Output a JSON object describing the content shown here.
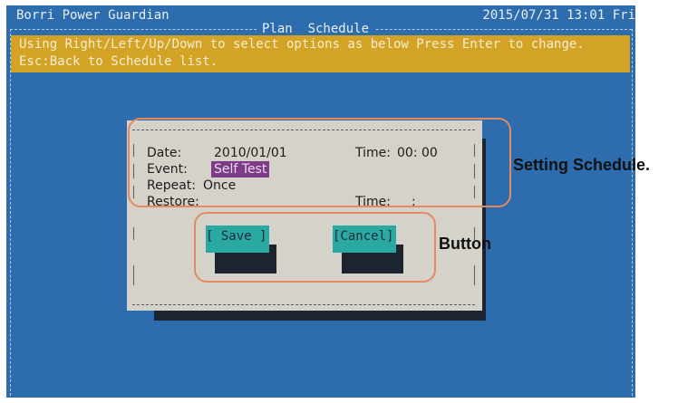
{
  "titlebar": {
    "app_name": "Borri Power Guardian",
    "datetime": "2015/07/31 13:01 Fri"
  },
  "frame": {
    "title": "Plan  Schedule"
  },
  "help": {
    "line1": "Using Right/Left/Up/Down to select options as below Press Enter to change.",
    "line2": "Esc:Back to Schedule list."
  },
  "schedule": {
    "date_label": "Date:",
    "date_value": "2010/01/01",
    "time_label": "Time:",
    "time_value": "00: 00",
    "event_label": "Event:",
    "event_value": "Self Test",
    "repeat_label": "Repeat:",
    "repeat_value": "Once",
    "restore_label": "Restore:",
    "restore_time_label": "Time:",
    "restore_time_value": ":"
  },
  "buttons": {
    "save_label": "[ Save ]",
    "cancel_label": "[Cancel]"
  },
  "annotations": {
    "setting_schedule": "Setting Schedule.",
    "button": "Button"
  },
  "colors": {
    "background": "#2d6cad",
    "help_bar": "#d2a325",
    "dialog": "#d4d2c9",
    "selected": "#7d3c88",
    "button": "#2aa9a2",
    "callout": "#e48a62"
  }
}
